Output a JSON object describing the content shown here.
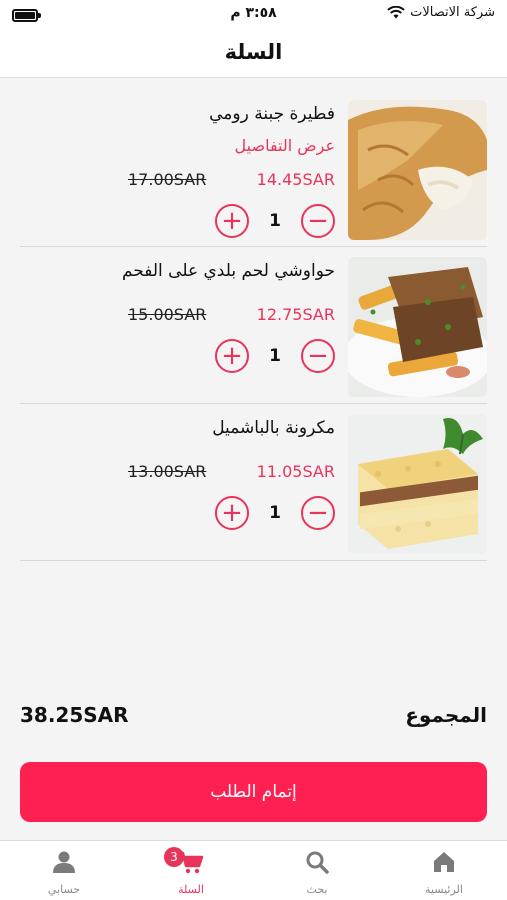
{
  "status_bar": {
    "carrier": "شركة الاتصالات",
    "time": "٣:٥٨ م"
  },
  "header": {
    "title": "السلة"
  },
  "items": [
    {
      "name": "فطيرة جبنة رومي",
      "details_label": "عرض التفاصيل",
      "price_new": "14.45SAR",
      "price_old": "17.00SAR",
      "quantity": "1",
      "plus": "+",
      "minus": "−"
    },
    {
      "name": "حواوشي لحم بلدي على الفحم",
      "price_new": "12.75SAR",
      "price_old": "15.00SAR",
      "quantity": "1",
      "plus": "+",
      "minus": "−"
    },
    {
      "name": "مكرونة بالباشميل",
      "price_new": "11.05SAR",
      "price_old": "13.00SAR",
      "quantity": "1",
      "plus": "+",
      "minus": "−"
    }
  ],
  "total": {
    "label": "المجموع",
    "value": "38.25SAR"
  },
  "checkout": {
    "label": "إتمام الطلب"
  },
  "tabbar": {
    "tabs": [
      {
        "label": "الرئيسية",
        "icon": "home-icon"
      },
      {
        "label": "بحث",
        "icon": "search-icon"
      },
      {
        "label": "السلة",
        "icon": "cart-icon",
        "badge": "3"
      },
      {
        "label": "حسابي",
        "icon": "user-icon"
      }
    ]
  },
  "colors": {
    "accent": "#e8345a",
    "button": "#ff2052",
    "background": "#f4f4f4"
  }
}
